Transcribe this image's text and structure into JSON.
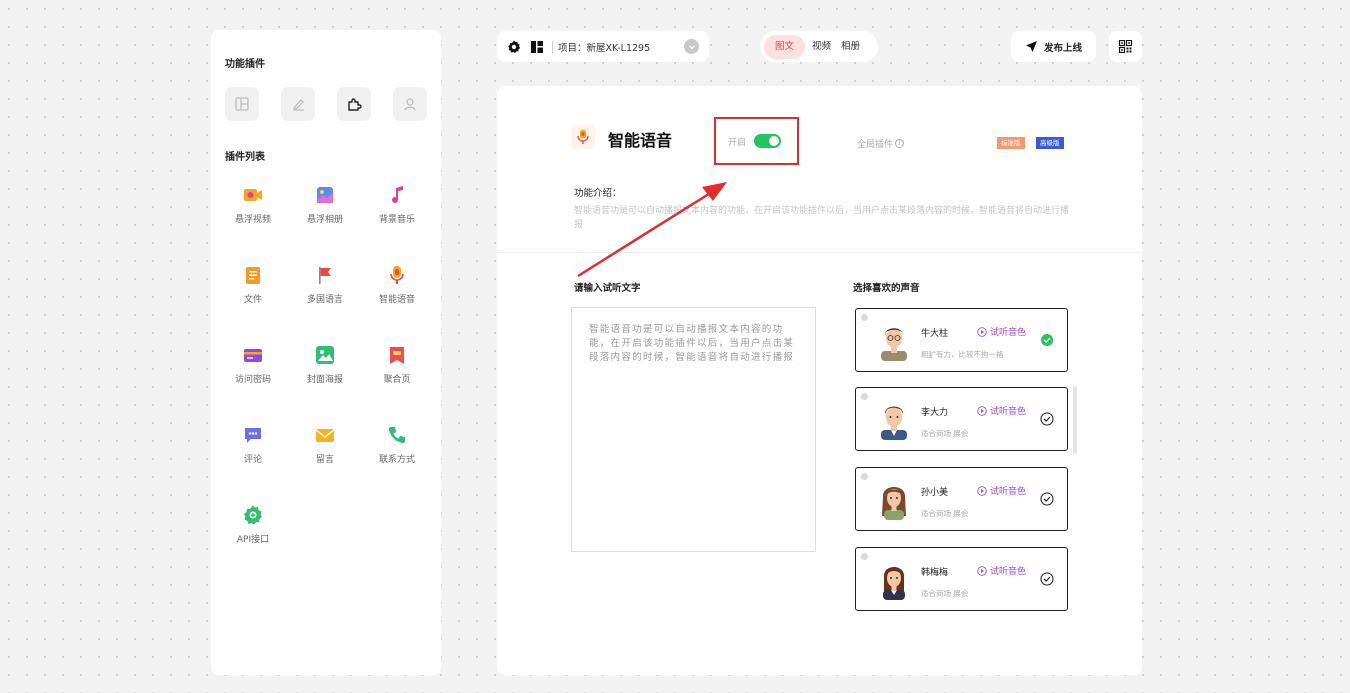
{
  "sidebar": {
    "function_plugins_title": "功能插件",
    "plugin_list_title": "插件列表",
    "tabs": [
      {
        "icon": "layout-icon"
      },
      {
        "icon": "edit-icon"
      },
      {
        "icon": "puzzle-icon"
      },
      {
        "icon": "user-icon"
      }
    ],
    "plugins": [
      {
        "label": "悬浮视频",
        "icon": "video-icon",
        "color": "#f5a623"
      },
      {
        "label": "悬浮相册",
        "icon": "photo-album-icon",
        "color": "#5b8def"
      },
      {
        "label": "背景音乐",
        "icon": "music-note-icon",
        "color": "#e53e8f"
      },
      {
        "label": "文件",
        "icon": "file-icon",
        "color": "#f59a23"
      },
      {
        "label": "多国语言",
        "icon": "flag-icon",
        "color": "#ef4a3c"
      },
      {
        "label": "智能语音",
        "icon": "microphone-icon",
        "color": "#f5a623"
      },
      {
        "label": "访问密码",
        "icon": "card-icon",
        "color": "#8c4be8"
      },
      {
        "label": "封面海报",
        "icon": "image-icon",
        "color": "#2fbf71"
      },
      {
        "label": "聚合页",
        "icon": "bookmark-icon",
        "color": "#ef4a5a"
      },
      {
        "label": "评论",
        "icon": "comment-icon",
        "color": "#6b6ef0"
      },
      {
        "label": "留言",
        "icon": "envelope-icon",
        "color": "#f5b223"
      },
      {
        "label": "联系方式",
        "icon": "phone-icon",
        "color": "#2fbf71"
      },
      {
        "label": "API接口",
        "icon": "api-gear-icon",
        "color": "#2fbf71"
      }
    ]
  },
  "topbar": {
    "project_text": "项目：新屋XK-L1295",
    "tabs": [
      "图文",
      "视频",
      "相册"
    ],
    "active_tab": "图文",
    "publish_label": "发布上线"
  },
  "feature": {
    "title": "智能语音",
    "toggle_label": "开启",
    "toggle_on": true,
    "global_plugin_label": "全局插件",
    "badges": [
      "标准版",
      "高级版"
    ],
    "intro_label": "功能介绍：",
    "intro_text": "智能语音功是可以自动播报文本内容的功能，在开启该功能插件以后，当用户点击某段落内容的时候，智能语音将自动进行播报",
    "input_label": "请输入试听文字",
    "input_value": "智能语音功是可以自动播报文本内容的功能，在开启该功能插件以后，当用户点击某段落内容的时候，智能语音将自动进行播报",
    "voice_label": "选择喜欢的声音",
    "voices": [
      {
        "name": "牛大柱",
        "desc": "粗犷有力，比较不拘一格",
        "preview": "试听音色",
        "selected": true
      },
      {
        "name": "李大力",
        "desc": "适合商场 展会",
        "preview": "试听音色",
        "selected": false
      },
      {
        "name": "孙小美",
        "desc": "适合商场 展会",
        "preview": "试听音色",
        "selected": false
      },
      {
        "name": "韩梅梅",
        "desc": "适合商场 展会",
        "preview": "试听音色",
        "selected": false
      }
    ]
  },
  "colors": {
    "accent_red": "#e2454d",
    "toggle_green": "#22c55e",
    "preview_purple": "#a346e0",
    "annotation_red": "#e52b2b"
  }
}
